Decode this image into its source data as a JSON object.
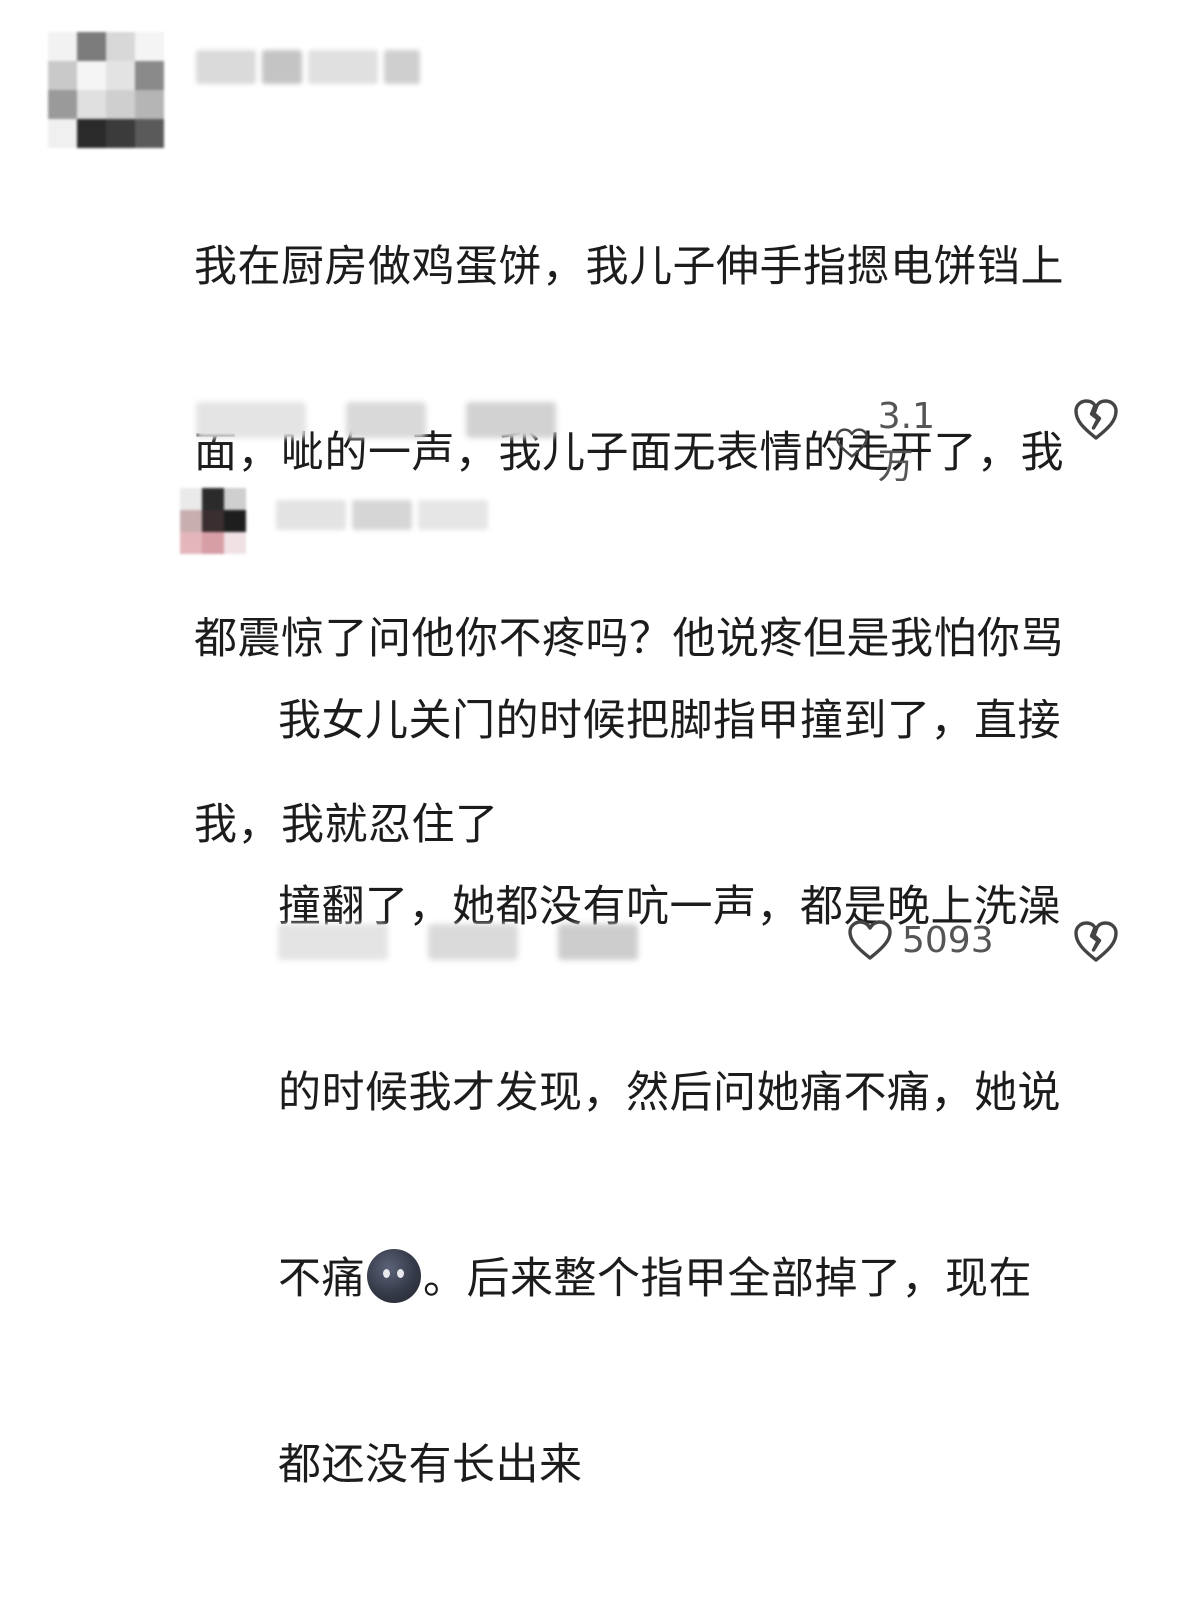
{
  "comments": [
    {
      "text": "我在厨房做鸡蛋饼，我儿子伸手指摁电饼铛上面，呲的一声，我儿子面无表情的走开了，我都震惊了问他你不疼吗？他说疼但是我怕你骂我，我就忍住了",
      "lines": [
        "我在厨房做鸡蛋饼，我儿子伸手指摁电饼铛上",
        "面，呲的一声，我儿子面无表情的走开了，我",
        "都震惊了问他你不疼吗？他说疼但是我怕你骂",
        "我，我就忍住了"
      ],
      "like_count": "3.1万"
    },
    {
      "lines": [
        "我女儿关门的时候把脚指甲撞到了，直接",
        "撞翻了，她都没有吭一声，都是晚上洗澡",
        "的时候我才发现，然后问她痛不痛，她说",
        "。后来整个指甲全部掉了，现在",
        "都还没有长出来"
      ],
      "line4_prefix": "不痛",
      "like_count": "5093"
    }
  ],
  "icons": {
    "like": "heart-outline-icon",
    "dislike": "broken-heart-icon",
    "emoji": "dark-moon-face-emoji"
  },
  "colors": {
    "text": "#1c1c1c",
    "meta": "#555555",
    "icon": "#444444"
  }
}
